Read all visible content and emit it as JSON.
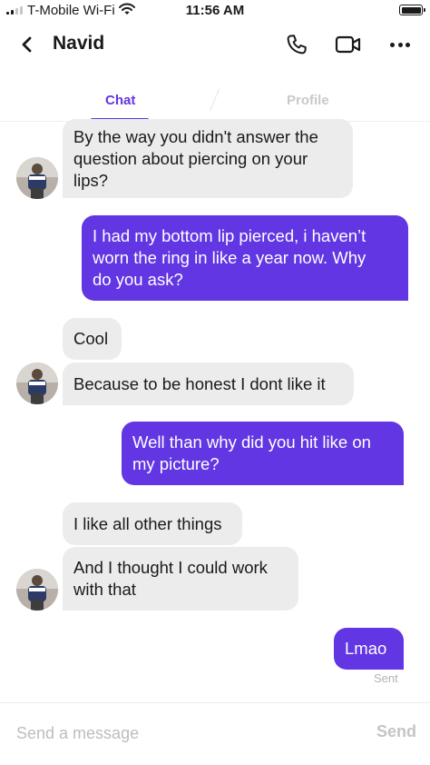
{
  "status_bar": {
    "carrier": "T-Mobile Wi-Fi",
    "time": "11:56 AM"
  },
  "header": {
    "contact_name": "Navid",
    "back_icon": "chevron-left-icon",
    "call_icon": "phone-icon",
    "video_icon": "video-camera-icon",
    "more_icon": "more-horizontal-icon"
  },
  "tabs": {
    "active": "Chat",
    "chat_label": "Chat",
    "profile_label": "Profile"
  },
  "colors": {
    "accent": "#6236e3",
    "incoming_bubble": "#ececec",
    "outgoing_text": "#ffffff"
  },
  "messages": [
    {
      "from": "them",
      "lines": [
        "By the way you didn't answer the",
        "question about piercing on your",
        "lips?"
      ]
    },
    {
      "from": "me",
      "lines": [
        "I had my bottom lip pierced, i haven’t",
        "worn the ring in like a year now.  Why",
        "do you ask?"
      ]
    },
    {
      "from": "them",
      "lines": [
        "Cool"
      ]
    },
    {
      "from": "them",
      "lines": [
        "Because to be honest I dont like it"
      ]
    },
    {
      "from": "me",
      "lines": [
        "Well than why did you hit like on",
        "my picture?"
      ]
    },
    {
      "from": "them",
      "lines": [
        "I like all other things"
      ]
    },
    {
      "from": "them",
      "lines": [
        "And I thought I could work",
        "with that"
      ]
    },
    {
      "from": "me",
      "lines": [
        "Lmao"
      ]
    }
  ],
  "delivery_status": "Sent",
  "composer": {
    "placeholder": "Send a message",
    "value": "",
    "send_label": "Send"
  }
}
